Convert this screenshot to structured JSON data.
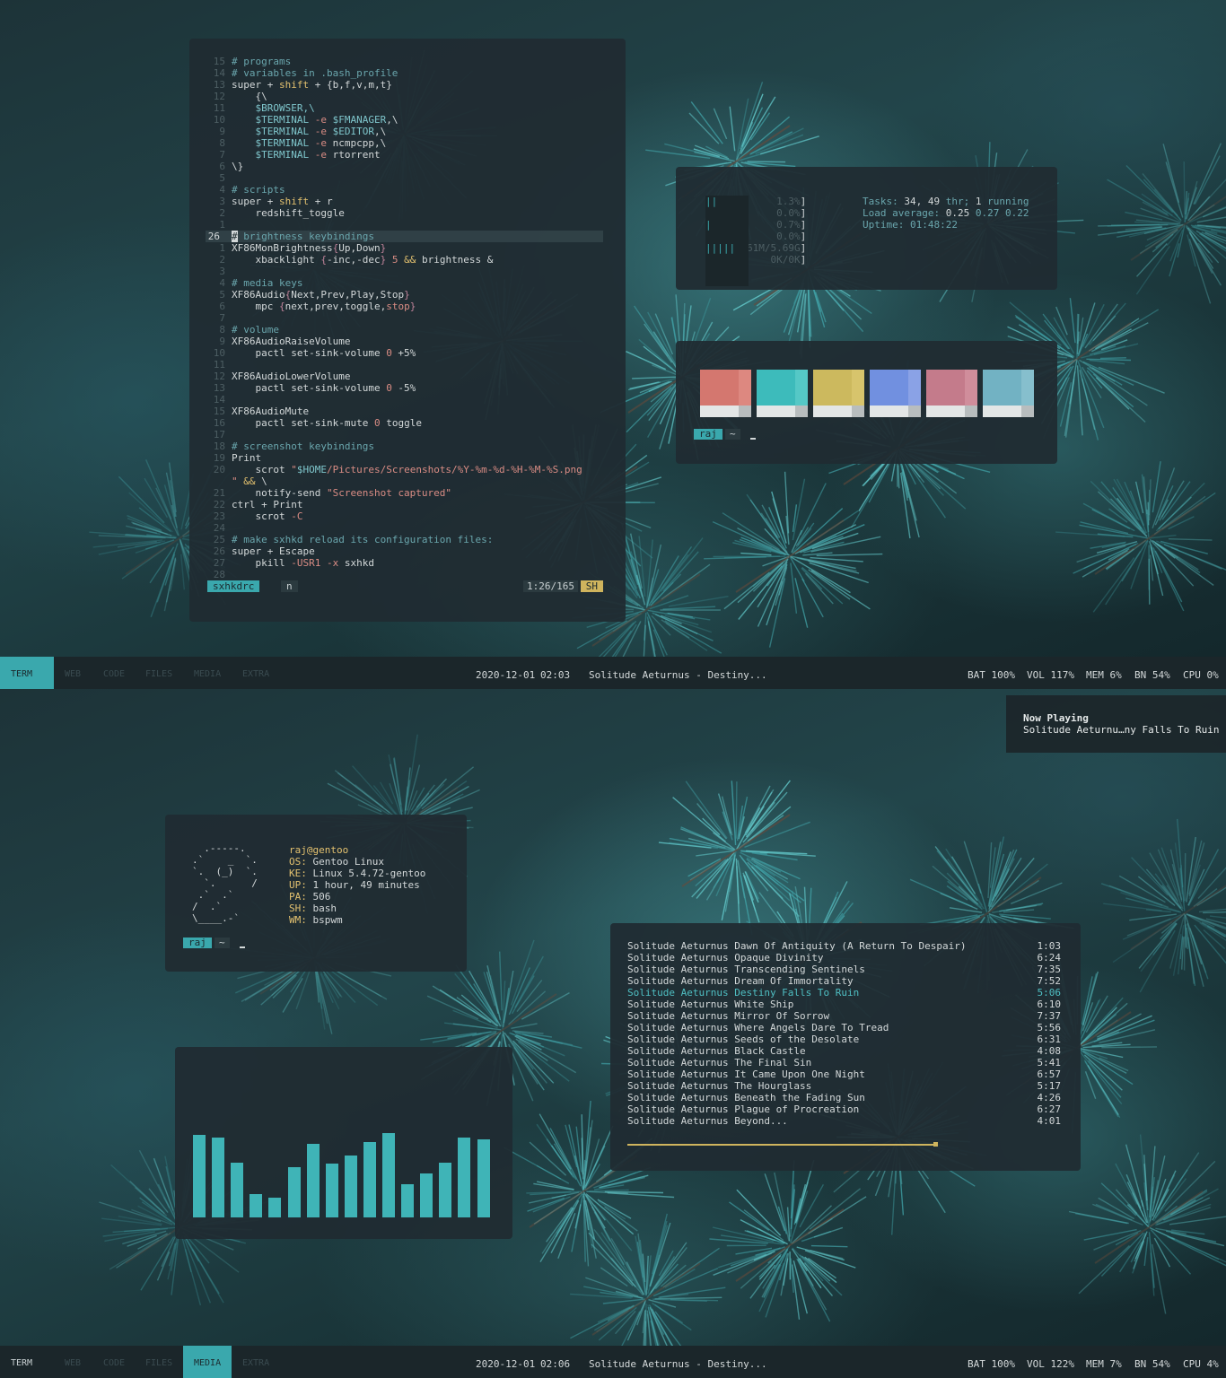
{
  "editor": {
    "lines": [
      {
        "n": "15",
        "t": "# programs",
        "cls": "c-cm"
      },
      {
        "n": "14",
        "t": "# variables in .bash_profile",
        "cls": "c-cm"
      },
      {
        "n": "13",
        "html": "super + <span class=\"c-kw\">shift</span> + {b,f,v,m,t}"
      },
      {
        "n": "12",
        "t": "    {\\",
        "cls": ""
      },
      {
        "n": "11",
        "t": "    $BROWSER,\\",
        "cls": "c-var"
      },
      {
        "n": "10",
        "html": "    <span class=\"c-var\">$TERMINAL</span> <span class=\"c-fl\">-e</span> <span class=\"c-var\">$FMANAGER</span>,\\"
      },
      {
        "n": "9",
        "html": "    <span class=\"c-var\">$TERMINAL</span> <span class=\"c-fl\">-e</span> <span class=\"c-var\">$EDITOR</span>,\\"
      },
      {
        "n": "8",
        "html": "    <span class=\"c-var\">$TERMINAL</span> <span class=\"c-fl\">-e</span> ncmpcpp,\\"
      },
      {
        "n": "7",
        "html": "    <span class=\"c-var\">$TERMINAL</span> <span class=\"c-fl\">-e</span> rtorrent"
      },
      {
        "n": "6",
        "t": "\\}",
        "cls": ""
      },
      {
        "n": "5",
        "t": "",
        "cls": ""
      },
      {
        "n": "4",
        "t": "# scripts",
        "cls": "c-cm"
      },
      {
        "n": "3",
        "html": "super + <span class=\"c-kw\">shift</span> + r"
      },
      {
        "n": "2",
        "t": "    redshift_toggle",
        "cls": ""
      },
      {
        "n": "1",
        "t": "",
        "cls": ""
      },
      {
        "n": "26",
        "html": "<span style=\"background:#d3d8d9;color:#1c2a2e\">#</span><span class=\"c-cm\"> brightness keybindings</span>",
        "current": true
      },
      {
        "n": "1",
        "html": "XF86MonBrightness<span class=\"c-pu\">{</span>Up,Down<span class=\"c-pu\">}</span>"
      },
      {
        "n": "2",
        "html": "    xbacklight <span class=\"c-pu\">{</span>-inc,-dec<span class=\"c-pu\">}</span> <span class=\"c-num\">5</span> <span class=\"c-kw\">&amp;&amp;</span> brightness &amp;"
      },
      {
        "n": "3",
        "t": "",
        "cls": ""
      },
      {
        "n": "4",
        "t": "# media keys",
        "cls": "c-cm"
      },
      {
        "n": "5",
        "html": "XF86Audio<span class=\"c-pu\">{</span>Next,Prev,Play,Stop<span class=\"c-pu\">}</span>"
      },
      {
        "n": "6",
        "html": "    mpc <span class=\"c-pu\">{</span>next,prev,toggle,<span class=\"c-str\">stop</span><span class=\"c-pu\">}</span>"
      },
      {
        "n": "7",
        "t": "",
        "cls": ""
      },
      {
        "n": "8",
        "t": "# volume",
        "cls": "c-cm"
      },
      {
        "n": "9",
        "t": "XF86AudioRaiseVolume",
        "cls": ""
      },
      {
        "n": "10",
        "html": "    pactl set-sink-volume <span class=\"c-num\">0</span> +5%"
      },
      {
        "n": "11",
        "t": "",
        "cls": ""
      },
      {
        "n": "12",
        "t": "XF86AudioLowerVolume",
        "cls": ""
      },
      {
        "n": "13",
        "html": "    pactl set-sink-volume <span class=\"c-num\">0</span> -5%"
      },
      {
        "n": "14",
        "t": "",
        "cls": ""
      },
      {
        "n": "15",
        "t": "XF86AudioMute",
        "cls": ""
      },
      {
        "n": "16",
        "html": "    pactl set-sink-mute <span class=\"c-num\">0</span> toggle"
      },
      {
        "n": "17",
        "t": "",
        "cls": ""
      },
      {
        "n": "18",
        "t": "# screenshot keybindings",
        "cls": "c-cm"
      },
      {
        "n": "19",
        "t": "Print",
        "cls": ""
      },
      {
        "n": "20",
        "html": "    scrot <span class=\"c-str\">\"</span><span class=\"c-var\">$HOME</span><span class=\"c-str\">/Pictures/Screenshots/%Y-%m-%d-%H-%M-%S.png</span>"
      },
      {
        "n": "",
        "html": "<span class=\"c-str\">\"</span> <span class=\"c-kw\">&amp;&amp;</span> \\"
      },
      {
        "n": "21",
        "html": "    notify-send <span class=\"c-str\">\"Screenshot captured\"</span>"
      },
      {
        "n": "22",
        "t": "ctrl + Print",
        "cls": ""
      },
      {
        "n": "23",
        "html": "    scrot <span class=\"c-fl\">-C</span>"
      },
      {
        "n": "24",
        "t": "",
        "cls": ""
      },
      {
        "n": "25",
        "t": "# make sxhkd reload its configuration files:",
        "cls": "c-cm"
      },
      {
        "n": "26",
        "t": "super + Escape",
        "cls": ""
      },
      {
        "n": "27",
        "html": "    pkill <span class=\"c-fl\">-USR1</span> <span class=\"c-fl\">-x</span> sxhkd"
      },
      {
        "n": "28",
        "t": "",
        "cls": ""
      }
    ],
    "status": {
      "file": "sxhkdrc",
      "mode": "n",
      "position": "1:26/165",
      "filetype": "SH"
    }
  },
  "htop": {
    "cpus": [
      {
        "id": "1",
        "bars": "||",
        "value": "1.3%"
      },
      {
        "id": "2",
        "bars": "",
        "value": "0.0%"
      },
      {
        "id": "3",
        "bars": "|",
        "value": "0.7%"
      },
      {
        "id": "4",
        "bars": "",
        "value": "0.0%"
      }
    ],
    "mem": {
      "label": "Mem",
      "bars": "|||||",
      "value": "261M/5.69G"
    },
    "swp": {
      "label": "Swp",
      "bars": "",
      "value": "0K/0K"
    },
    "tasks_label": "Tasks:",
    "tasks_value": "34,",
    "threads_value": "49",
    "threads_label": "thr;",
    "running_value": "1",
    "running_label": "running",
    "load_label": "Load average:",
    "load1": "0.25",
    "load5": "0.27",
    "load15": "0.22",
    "uptime_label": "Uptime:",
    "uptime": "01:48:22"
  },
  "palette": {
    "swatches": [
      {
        "color": "#d4776f",
        "hi": "#dd8880"
      },
      {
        "color": "#3dbbbb",
        "hi": "#55c8c6"
      },
      {
        "color": "#ccb95e",
        "hi": "#d7c46c"
      },
      {
        "color": "#7190e0",
        "hi": "#8aa2e6"
      },
      {
        "color": "#c47b8b",
        "hi": "#d08d9b"
      },
      {
        "color": "#72b2c3",
        "hi": "#86bfcd"
      }
    ]
  },
  "prompt": {
    "user": "raj",
    "dir": "~"
  },
  "topbar": {
    "workspaces": [
      {
        "label": "TERM",
        "state": "active"
      },
      {
        "label": "WEB",
        "state": "empty"
      },
      {
        "label": "CODE",
        "state": "empty"
      },
      {
        "label": "FILES",
        "state": "empty"
      },
      {
        "label": "MEDIA",
        "state": "empty"
      },
      {
        "label": "EXTRA",
        "state": "empty"
      }
    ],
    "date": "2020-12-01",
    "time": "02:03",
    "song": "Solitude Aeturnus - Destiny...",
    "bat": "BAT 100%",
    "vol": "VOL 117%",
    "mem": "MEM 6%",
    "bn": "BN 54%",
    "cpu": "CPU 0%"
  },
  "bottombar": {
    "workspaces": [
      {
        "label": "TERM",
        "state": "occ"
      },
      {
        "label": "WEB",
        "state": "empty"
      },
      {
        "label": "CODE",
        "state": "empty"
      },
      {
        "label": "FILES",
        "state": "empty"
      },
      {
        "label": "MEDIA",
        "state": "active"
      },
      {
        "label": "EXTRA",
        "state": "empty"
      }
    ],
    "date": "2020-12-01",
    "time": "02:06",
    "song": "Solitude Aeturnus - Destiny...",
    "bat": "BAT 100%",
    "vol": "VOL 122%",
    "mem": "MEM 7%",
    "bn": "BN 54%",
    "cpu": "CPU 4%"
  },
  "notification": {
    "title": "Now Playing",
    "body": "Solitude Aeturnu…ny Falls To Ruin"
  },
  "neofetch": {
    "art": "  .-----.\n.`    _  `.\n`.  (_)  `.\n  `.      /\n .`  .`\n/  .`\n\\____.-`",
    "host": "raj@gentoo",
    "info": [
      {
        "k": "OS:",
        "v": "Gentoo Linux"
      },
      {
        "k": "KE:",
        "v": "Linux 5.4.72-gentoo"
      },
      {
        "k": "UP:",
        "v": "1 hour, 49 minutes"
      },
      {
        "k": "PA:",
        "v": "506"
      },
      {
        "k": "SH:",
        "v": "bash"
      },
      {
        "k": "WM:",
        "v": "bspwm"
      }
    ]
  },
  "visualizer": {
    "levels": [
      0.92,
      0.89,
      0.61,
      0.26,
      0.22,
      0.56,
      0.82,
      0.6,
      0.69,
      0.84,
      0.94,
      0.37,
      0.49,
      0.61,
      0.89,
      0.87
    ],
    "color": "#3fb4b7"
  },
  "playlist": {
    "tracks": [
      {
        "title": "Solitude Aeturnus Dawn Of Antiquity (A Return To Despair)",
        "dur": "1:03"
      },
      {
        "title": "Solitude Aeturnus Opaque Divinity",
        "dur": "6:24"
      },
      {
        "title": "Solitude Aeturnus Transcending Sentinels",
        "dur": "7:35"
      },
      {
        "title": "Solitude Aeturnus Dream Of Immortality",
        "dur": "7:52"
      },
      {
        "title": "Solitude Aeturnus Destiny Falls To Ruin",
        "dur": "5:06",
        "playing": true
      },
      {
        "title": "Solitude Aeturnus White Ship",
        "dur": "6:10"
      },
      {
        "title": "Solitude Aeturnus Mirror Of Sorrow",
        "dur": "7:37"
      },
      {
        "title": "Solitude Aeturnus Where Angels Dare To Tread",
        "dur": "5:56"
      },
      {
        "title": "Solitude Aeturnus Seeds of the Desolate",
        "dur": "6:31"
      },
      {
        "title": "Solitude Aeturnus Black Castle",
        "dur": "4:08"
      },
      {
        "title": "Solitude Aeturnus The Final Sin",
        "dur": "5:41"
      },
      {
        "title": "Solitude Aeturnus It Came Upon One Night",
        "dur": "6:57"
      },
      {
        "title": "Solitude Aeturnus The Hourglass",
        "dur": "5:17"
      },
      {
        "title": "Solitude Aeturnus Beneath the Fading Sun",
        "dur": "4:26"
      },
      {
        "title": "Solitude Aeturnus Plague of Procreation",
        "dur": "6:27"
      },
      {
        "title": "Solitude Aeturnus Beyond...",
        "dur": "4:01"
      }
    ],
    "progress": 0.71
  }
}
